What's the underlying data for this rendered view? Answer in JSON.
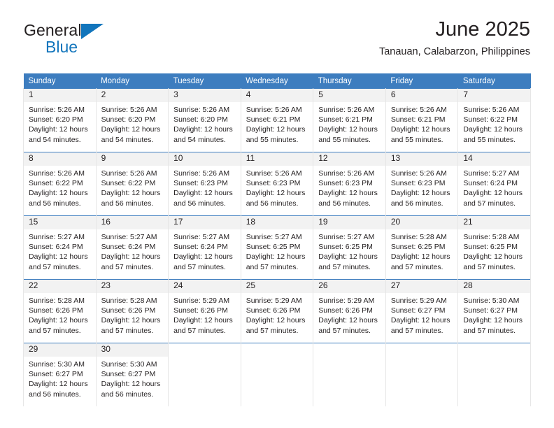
{
  "brand": {
    "name_part1": "General",
    "name_part2": "Blue",
    "triangle_color": "#1275bc"
  },
  "header": {
    "title": "June 2025",
    "subtitle": "Tanauan, Calabarzon, Philippines"
  },
  "theme": {
    "header_bg": "#3d7dbf",
    "header_text": "#ffffff",
    "daynum_bg": "#f2f2f2",
    "grid_line": "#e6e6e6",
    "row_top_line": "#3d7dbf"
  },
  "weekdays": [
    "Sunday",
    "Monday",
    "Tuesday",
    "Wednesday",
    "Thursday",
    "Friday",
    "Saturday"
  ],
  "days": [
    {
      "n": "1",
      "sunrise": "Sunrise: 5:26 AM",
      "sunset": "Sunset: 6:20 PM",
      "daylight1": "Daylight: 12 hours",
      "daylight2": "and 54 minutes."
    },
    {
      "n": "2",
      "sunrise": "Sunrise: 5:26 AM",
      "sunset": "Sunset: 6:20 PM",
      "daylight1": "Daylight: 12 hours",
      "daylight2": "and 54 minutes."
    },
    {
      "n": "3",
      "sunrise": "Sunrise: 5:26 AM",
      "sunset": "Sunset: 6:20 PM",
      "daylight1": "Daylight: 12 hours",
      "daylight2": "and 54 minutes."
    },
    {
      "n": "4",
      "sunrise": "Sunrise: 5:26 AM",
      "sunset": "Sunset: 6:21 PM",
      "daylight1": "Daylight: 12 hours",
      "daylight2": "and 55 minutes."
    },
    {
      "n": "5",
      "sunrise": "Sunrise: 5:26 AM",
      "sunset": "Sunset: 6:21 PM",
      "daylight1": "Daylight: 12 hours",
      "daylight2": "and 55 minutes."
    },
    {
      "n": "6",
      "sunrise": "Sunrise: 5:26 AM",
      "sunset": "Sunset: 6:21 PM",
      "daylight1": "Daylight: 12 hours",
      "daylight2": "and 55 minutes."
    },
    {
      "n": "7",
      "sunrise": "Sunrise: 5:26 AM",
      "sunset": "Sunset: 6:22 PM",
      "daylight1": "Daylight: 12 hours",
      "daylight2": "and 55 minutes."
    },
    {
      "n": "8",
      "sunrise": "Sunrise: 5:26 AM",
      "sunset": "Sunset: 6:22 PM",
      "daylight1": "Daylight: 12 hours",
      "daylight2": "and 56 minutes."
    },
    {
      "n": "9",
      "sunrise": "Sunrise: 5:26 AM",
      "sunset": "Sunset: 6:22 PM",
      "daylight1": "Daylight: 12 hours",
      "daylight2": "and 56 minutes."
    },
    {
      "n": "10",
      "sunrise": "Sunrise: 5:26 AM",
      "sunset": "Sunset: 6:23 PM",
      "daylight1": "Daylight: 12 hours",
      "daylight2": "and 56 minutes."
    },
    {
      "n": "11",
      "sunrise": "Sunrise: 5:26 AM",
      "sunset": "Sunset: 6:23 PM",
      "daylight1": "Daylight: 12 hours",
      "daylight2": "and 56 minutes."
    },
    {
      "n": "12",
      "sunrise": "Sunrise: 5:26 AM",
      "sunset": "Sunset: 6:23 PM",
      "daylight1": "Daylight: 12 hours",
      "daylight2": "and 56 minutes."
    },
    {
      "n": "13",
      "sunrise": "Sunrise: 5:26 AM",
      "sunset": "Sunset: 6:23 PM",
      "daylight1": "Daylight: 12 hours",
      "daylight2": "and 56 minutes."
    },
    {
      "n": "14",
      "sunrise": "Sunrise: 5:27 AM",
      "sunset": "Sunset: 6:24 PM",
      "daylight1": "Daylight: 12 hours",
      "daylight2": "and 57 minutes."
    },
    {
      "n": "15",
      "sunrise": "Sunrise: 5:27 AM",
      "sunset": "Sunset: 6:24 PM",
      "daylight1": "Daylight: 12 hours",
      "daylight2": "and 57 minutes."
    },
    {
      "n": "16",
      "sunrise": "Sunrise: 5:27 AM",
      "sunset": "Sunset: 6:24 PM",
      "daylight1": "Daylight: 12 hours",
      "daylight2": "and 57 minutes."
    },
    {
      "n": "17",
      "sunrise": "Sunrise: 5:27 AM",
      "sunset": "Sunset: 6:24 PM",
      "daylight1": "Daylight: 12 hours",
      "daylight2": "and 57 minutes."
    },
    {
      "n": "18",
      "sunrise": "Sunrise: 5:27 AM",
      "sunset": "Sunset: 6:25 PM",
      "daylight1": "Daylight: 12 hours",
      "daylight2": "and 57 minutes."
    },
    {
      "n": "19",
      "sunrise": "Sunrise: 5:27 AM",
      "sunset": "Sunset: 6:25 PM",
      "daylight1": "Daylight: 12 hours",
      "daylight2": "and 57 minutes."
    },
    {
      "n": "20",
      "sunrise": "Sunrise: 5:28 AM",
      "sunset": "Sunset: 6:25 PM",
      "daylight1": "Daylight: 12 hours",
      "daylight2": "and 57 minutes."
    },
    {
      "n": "21",
      "sunrise": "Sunrise: 5:28 AM",
      "sunset": "Sunset: 6:25 PM",
      "daylight1": "Daylight: 12 hours",
      "daylight2": "and 57 minutes."
    },
    {
      "n": "22",
      "sunrise": "Sunrise: 5:28 AM",
      "sunset": "Sunset: 6:26 PM",
      "daylight1": "Daylight: 12 hours",
      "daylight2": "and 57 minutes."
    },
    {
      "n": "23",
      "sunrise": "Sunrise: 5:28 AM",
      "sunset": "Sunset: 6:26 PM",
      "daylight1": "Daylight: 12 hours",
      "daylight2": "and 57 minutes."
    },
    {
      "n": "24",
      "sunrise": "Sunrise: 5:29 AM",
      "sunset": "Sunset: 6:26 PM",
      "daylight1": "Daylight: 12 hours",
      "daylight2": "and 57 minutes."
    },
    {
      "n": "25",
      "sunrise": "Sunrise: 5:29 AM",
      "sunset": "Sunset: 6:26 PM",
      "daylight1": "Daylight: 12 hours",
      "daylight2": "and 57 minutes."
    },
    {
      "n": "26",
      "sunrise": "Sunrise: 5:29 AM",
      "sunset": "Sunset: 6:26 PM",
      "daylight1": "Daylight: 12 hours",
      "daylight2": "and 57 minutes."
    },
    {
      "n": "27",
      "sunrise": "Sunrise: 5:29 AM",
      "sunset": "Sunset: 6:27 PM",
      "daylight1": "Daylight: 12 hours",
      "daylight2": "and 57 minutes."
    },
    {
      "n": "28",
      "sunrise": "Sunrise: 5:30 AM",
      "sunset": "Sunset: 6:27 PM",
      "daylight1": "Daylight: 12 hours",
      "daylight2": "and 57 minutes."
    },
    {
      "n": "29",
      "sunrise": "Sunrise: 5:30 AM",
      "sunset": "Sunset: 6:27 PM",
      "daylight1": "Daylight: 12 hours",
      "daylight2": "and 56 minutes."
    },
    {
      "n": "30",
      "sunrise": "Sunrise: 5:30 AM",
      "sunset": "Sunset: 6:27 PM",
      "daylight1": "Daylight: 12 hours",
      "daylight2": "and 56 minutes."
    }
  ],
  "layout": {
    "first_day_column_index": 0,
    "weeks": 5,
    "columns": 7
  }
}
